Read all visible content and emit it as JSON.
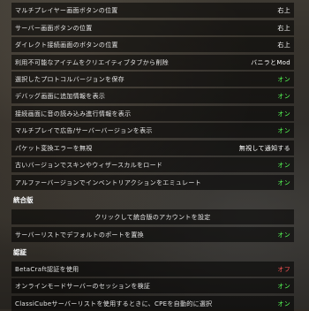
{
  "settings": [
    {
      "label": "マルチプレイヤー画面ボタンの位置",
      "value": "右上",
      "state": "neutral"
    },
    {
      "label": "サーバー画面ボタンの位置",
      "value": "右上",
      "state": "neutral"
    },
    {
      "label": "ダイレクト接続画面のボタンの位置",
      "value": "右上",
      "state": "neutral"
    },
    {
      "label": "利用不可能なアイテムをクリエイティブタブから削除",
      "value": "バニラとMod",
      "state": "neutral"
    },
    {
      "label": "選択したプロトコルバージョンを保存",
      "value": "オン",
      "state": "on"
    },
    {
      "label": "デバッグ画面に追加情報を表示",
      "value": "オン",
      "state": "on"
    },
    {
      "label": "接続画面に音の読み込み進行情報を表示",
      "value": "オン",
      "state": "on"
    },
    {
      "label": "マルチプレイで広告/サーバーバージョンを表示",
      "value": "オン",
      "state": "on"
    },
    {
      "label": "パケット変換エラーを無視",
      "value": "無視して通知する",
      "state": "neutral"
    },
    {
      "label": "古いバージョンでスキンやウィザースカルをロード",
      "value": "オン",
      "state": "on"
    },
    {
      "label": "アルファーバージョンでインベントリアクションをエミュレート",
      "value": "オン",
      "state": "on"
    }
  ],
  "section_integrated": "統合版",
  "integrated": {
    "account_button": "クリックして統合版のアカウントを設定",
    "replace_port": {
      "label": "サーバーリストでデフォルトのポートを置換",
      "value": "オン",
      "state": "on"
    }
  },
  "section_auth": "認証",
  "auth": [
    {
      "label": "BetaCraft認証を使用",
      "value": "オフ",
      "state": "off"
    },
    {
      "label": "オンラインモードサーバーのセッションを検証",
      "value": "オン",
      "state": "on"
    },
    {
      "label": "ClassiCubeサーバーリストを使用するときに、CPEを自動的に選択",
      "value": "オン",
      "state": "on"
    }
  ],
  "colors": {
    "on": "#55ff55",
    "off": "#ff5555",
    "neutral": "#ffffff"
  }
}
